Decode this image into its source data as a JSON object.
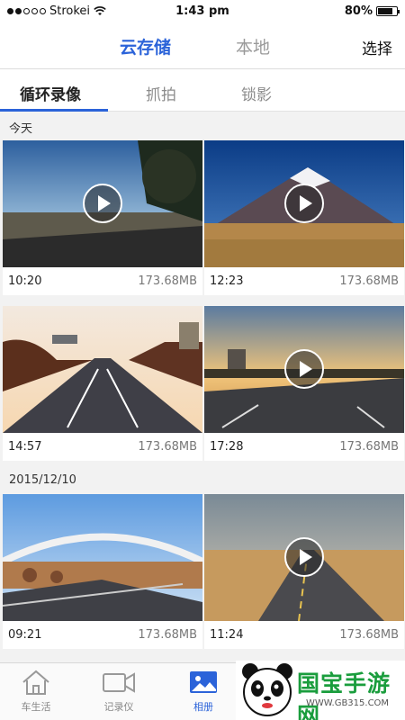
{
  "status_bar": {
    "carrier": "Strokei",
    "time": "1:43 pm",
    "battery": "80%",
    "battery_level": 0.8
  },
  "header": {
    "tabs": [
      "云存储",
      "本地"
    ],
    "active_tab": "云存储",
    "select_label": "选择"
  },
  "sub_tabs": {
    "items": [
      "循环录像",
      "抓拍",
      "锁影"
    ],
    "active": "循环录像"
  },
  "sections": [
    {
      "label": "今天",
      "videos": [
        {
          "time": "10:20",
          "size": "173.68MB"
        },
        {
          "time": "12:23",
          "size": "173.68MB"
        },
        {
          "time": "14:57",
          "size": "173.68MB"
        },
        {
          "time": "17:28",
          "size": "173.68MB"
        }
      ]
    },
    {
      "label": "2015/12/10",
      "videos": [
        {
          "time": "09:21",
          "size": "173.68MB"
        },
        {
          "time": "11:24",
          "size": "173.68MB"
        }
      ]
    }
  ],
  "bottom_nav": {
    "items": [
      {
        "label": "车生活",
        "icon": "home-icon"
      },
      {
        "label": "记录仪",
        "icon": "video-camera-icon"
      },
      {
        "label": "相册",
        "icon": "photo-icon"
      }
    ],
    "active": "相册"
  },
  "watermark": {
    "text": "国宝手游网",
    "url": "WWW.GB315.COM"
  },
  "colors": {
    "accent": "#2b63d9",
    "watermark_green": "#1a9d3d"
  }
}
